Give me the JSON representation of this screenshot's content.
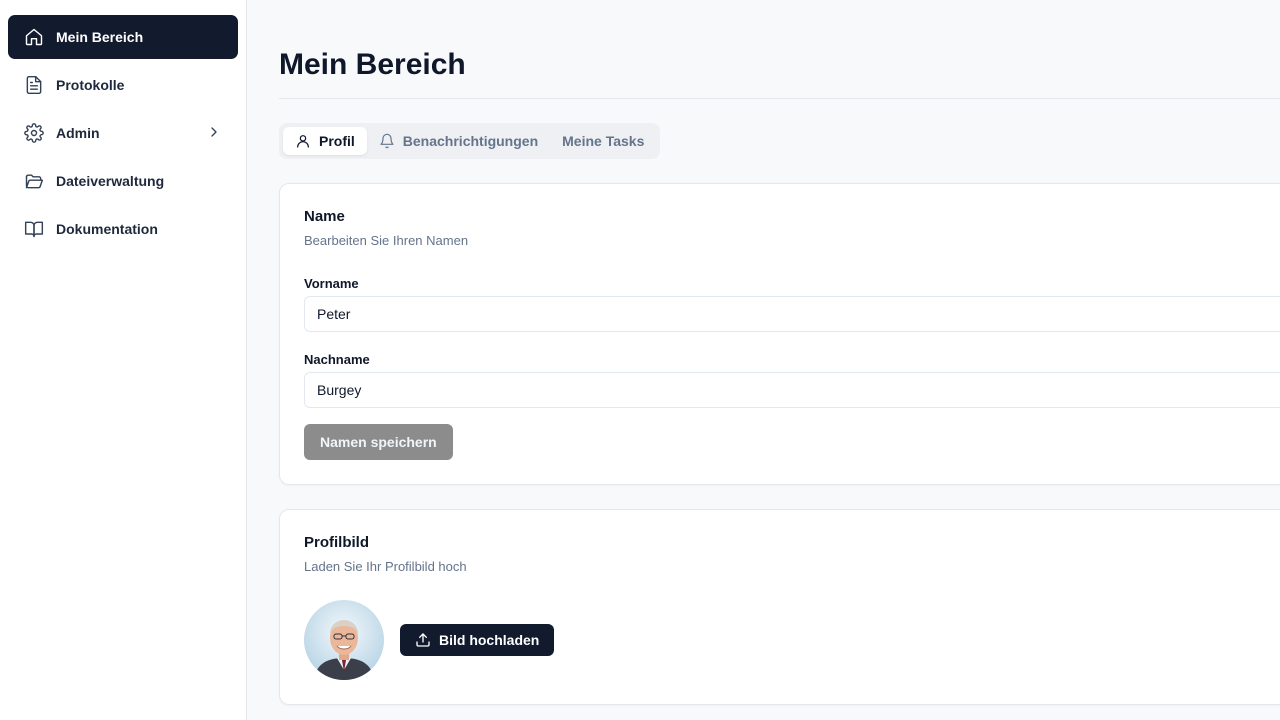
{
  "sidebar": {
    "items": [
      {
        "label": "Mein Bereich",
        "icon": "home-icon"
      },
      {
        "label": "Protokolle",
        "icon": "file-text-icon"
      },
      {
        "label": "Admin",
        "icon": "gear-icon"
      },
      {
        "label": "Dateiverwaltung",
        "icon": "folder-open-icon"
      },
      {
        "label": "Dokumentation",
        "icon": "book-open-icon"
      }
    ]
  },
  "main": {
    "title": "Mein Bereich",
    "tabs": [
      {
        "label": "Profil",
        "icon": "user-icon"
      },
      {
        "label": "Benachrichtigungen",
        "icon": "bell-icon"
      },
      {
        "label": "Meine Tasks"
      }
    ],
    "name_card": {
      "title": "Name",
      "description": "Bearbeiten Sie Ihren Namen",
      "first_name_label": "Vorname",
      "first_name_value": "Peter",
      "last_name_label": "Nachname",
      "last_name_value": "Burgey",
      "save_label": "Namen speichern"
    },
    "picture_card": {
      "title": "Profilbild",
      "description": "Laden Sie Ihr Profilbild hoch",
      "upload_label": "Bild hochladen"
    }
  },
  "colors": {
    "accent": "#121a2e",
    "disabled_button": "#8c8c8c",
    "muted_text": "#64748b"
  }
}
